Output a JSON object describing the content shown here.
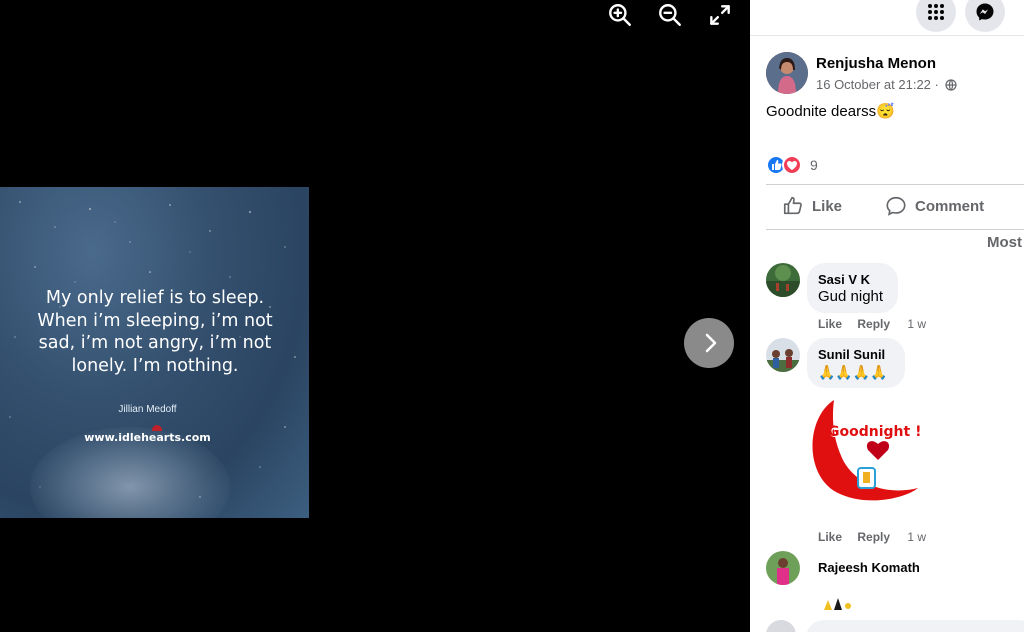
{
  "viewer": {
    "toolbar": [
      "zoom-in",
      "zoom-out",
      "fullscreen"
    ],
    "photo": {
      "quote": "My only relief is to sleep. When i’m sleeping, i’m not sad, i’m not angry, i’m not lonely. I’m nothing.",
      "author": "Jillian Medoff",
      "site": "www.idlehearts.com"
    }
  },
  "post": {
    "author_name": "Renjusha Menon",
    "timestamp": "16 October at 21:22 ·",
    "text": "Goodnite dearss😴",
    "reaction_count": "9",
    "like_label": "Like",
    "comment_label": "Comment",
    "sort_label": "Most"
  },
  "comments": [
    {
      "name": "Sasi V K",
      "text": "Gud night",
      "like": "Like",
      "reply": "Reply",
      "age": "1 w"
    },
    {
      "name": "Sunil Sunil",
      "text": "🙏🙏🙏🙏",
      "sticker_text": "Goodnight !",
      "like": "Like",
      "reply": "Reply",
      "age": "1 w"
    },
    {
      "name": "Rajeesh Komath"
    }
  ],
  "colors": {
    "like_blue": "#1877f2",
    "love_red": "#f33e58",
    "panel_bg": "#ffffff"
  }
}
